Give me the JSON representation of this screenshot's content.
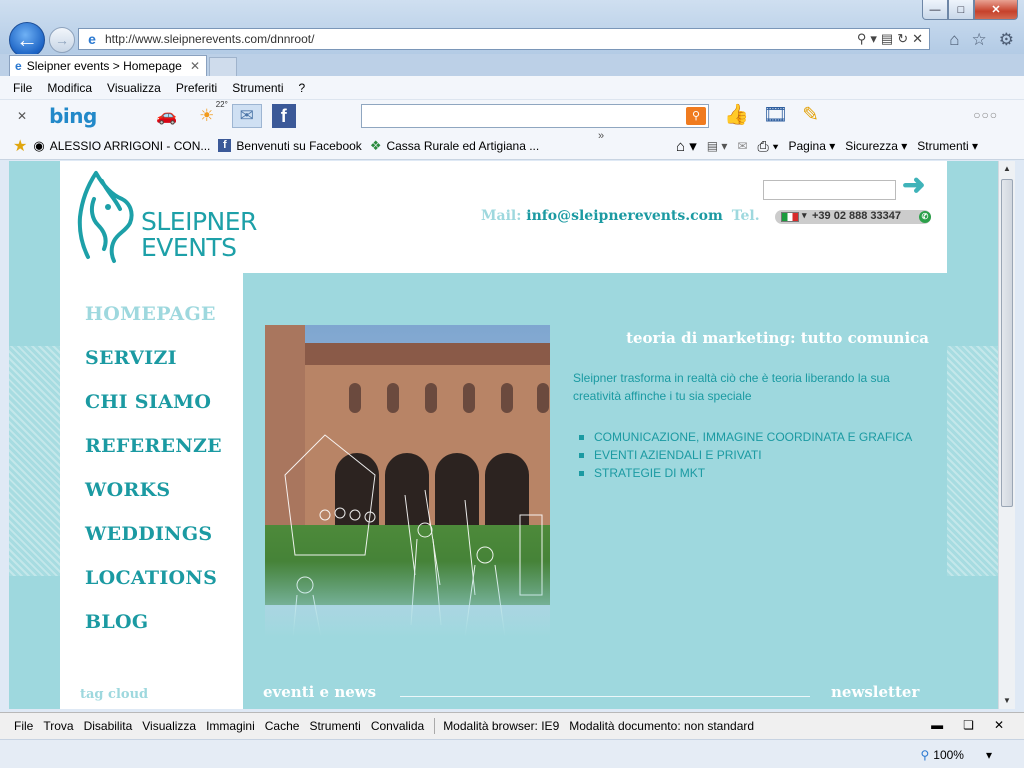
{
  "browser": {
    "address_url": "http://www.sleipnerevents.com/dnnroot/",
    "tab_title": "Sleipner events > Homepage",
    "menu": [
      "File",
      "Modifica",
      "Visualizza",
      "Preferiti",
      "Strumenti",
      "?"
    ],
    "bing": {
      "logo": "bing",
      "weather": "22°"
    },
    "favorites": [
      {
        "label": "ALESSIO ARRIGONI - CON...",
        "icon": "site-icon"
      },
      {
        "label": "Benvenuti su Facebook",
        "icon": "facebook-icon"
      },
      {
        "label": "Cassa Rurale ed Artigiana ...",
        "icon": "bank-icon"
      }
    ],
    "commands": [
      "Pagina",
      "Sicurezza",
      "Strumenti"
    ],
    "devbar": [
      "File",
      "Trova",
      "Disabilita",
      "Visualizza",
      "Immagini",
      "Cache",
      "Strumenti",
      "Convalida"
    ],
    "browser_mode": "Modalità browser: IE9",
    "document_mode": "Modalità documento: non standard",
    "zoom": "100%"
  },
  "site": {
    "logo_line1": "SLEIPNER",
    "logo_line2": "EVENTS",
    "contact": {
      "mail_label": "Mail:",
      "mail": "info@sleipnerevents.com",
      "tel_label": "Tel.",
      "phone": "+39 02 888 33347"
    },
    "nav": [
      "HOMEPAGE",
      "SERVIZI",
      "CHI SIAMO",
      "REFERENZE",
      "WORKS",
      "WEDDINGS",
      "LOCATIONS",
      "BLOG"
    ],
    "active_nav": "HOMEPAGE",
    "tag_cloud": "tag cloud",
    "headline": "teoria di marketing: tutto comunica",
    "intro": "Sleipner trasforma in realtà ciò che è teoria liberando la sua creatività affinche i tu sia speciale",
    "services": [
      "COMUNICAZIONE, IMMAGINE COORDINATA E GRAFICA",
      "EVENTI AZIENDALI E PRIVATI",
      "STRATEGIE DI MKT"
    ],
    "eventi": "eventi e news",
    "newsletter": "newsletter"
  },
  "colors": {
    "teal": "#1b9aa2",
    "light_teal": "#9ed8de"
  }
}
